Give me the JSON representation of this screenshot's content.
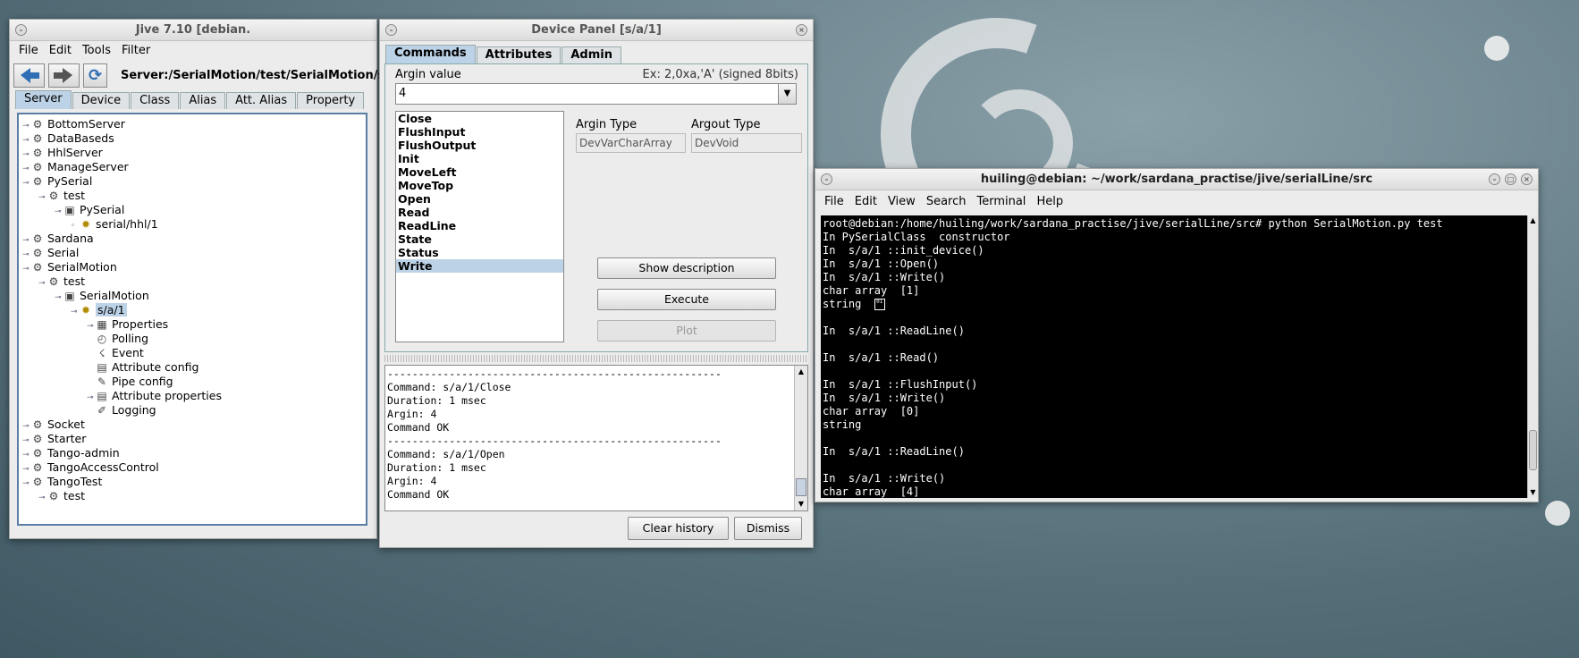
{
  "jive": {
    "title": "Jive 7.10 [debian.",
    "menus": [
      "File",
      "Edit",
      "Tools",
      "Filter"
    ],
    "path": "Server:/SerialMotion/test/SerialMotion/s/",
    "tabs": [
      "Server",
      "Device",
      "Class",
      "Alias",
      "Att. Alias",
      "Property"
    ],
    "tree": [
      {
        "label": "BottomServer",
        "icon": "server-icon",
        "depth": 0
      },
      {
        "label": "DataBaseds",
        "icon": "server-icon",
        "depth": 0
      },
      {
        "label": "HhlServer",
        "icon": "server-icon",
        "depth": 0
      },
      {
        "label": "ManageServer",
        "icon": "server-icon",
        "depth": 0
      },
      {
        "label": "PySerial",
        "icon": "server-icon",
        "depth": 0
      },
      {
        "label": "test",
        "icon": "instance-icon",
        "depth": 1
      },
      {
        "label": "PySerial",
        "icon": "class-icon",
        "depth": 2
      },
      {
        "label": "serial/hhl/1",
        "icon": "device-icon",
        "depth": 3
      },
      {
        "label": "Sardana",
        "icon": "server-icon",
        "depth": 0
      },
      {
        "label": "Serial",
        "icon": "server-icon",
        "depth": 0
      },
      {
        "label": "SerialMotion",
        "icon": "server-icon",
        "depth": 0
      },
      {
        "label": "test",
        "icon": "instance-icon",
        "depth": 1
      },
      {
        "label": "SerialMotion",
        "icon": "class-icon",
        "depth": 2
      },
      {
        "label": "s/a/1",
        "icon": "device-icon",
        "depth": 3,
        "selected": true
      },
      {
        "label": "Properties",
        "icon": "properties-icon",
        "depth": 4
      },
      {
        "label": "Polling",
        "icon": "polling-icon",
        "depth": 4
      },
      {
        "label": "Event",
        "icon": "event-icon",
        "depth": 4
      },
      {
        "label": "Attribute config",
        "icon": "attribute-config-icon",
        "depth": 4
      },
      {
        "label": "Pipe config",
        "icon": "pipe-icon",
        "depth": 4
      },
      {
        "label": "Attribute properties",
        "icon": "attribute-properties-icon",
        "depth": 4
      },
      {
        "label": "Logging",
        "icon": "logging-icon",
        "depth": 4
      },
      {
        "label": "Socket",
        "icon": "server-icon",
        "depth": 0
      },
      {
        "label": "Starter",
        "icon": "server-icon",
        "depth": 0
      },
      {
        "label": "Tango-admin",
        "icon": "server-icon",
        "depth": 0
      },
      {
        "label": "TangoAccessControl",
        "icon": "server-icon",
        "depth": 0
      },
      {
        "label": "TangoTest",
        "icon": "server-icon",
        "depth": 0
      },
      {
        "label": "test",
        "icon": "instance-icon",
        "depth": 1
      }
    ]
  },
  "panel": {
    "title": "Device Panel [s/a/1]",
    "tabs": [
      "Commands",
      "Attributes",
      "Admin"
    ],
    "argin_label": "Argin value",
    "argin_example": "Ex: 2,0xa,'A' (signed 8bits)",
    "argin_value": "4",
    "commands": [
      "Close",
      "FlushInput",
      "FlushOutput",
      "Init",
      "MoveLeft",
      "MoveTop",
      "Open",
      "Read",
      "ReadLine",
      "State",
      "Status",
      "Write"
    ],
    "selected_command": "Write",
    "argin_type_label": "Argin Type",
    "argin_type": "DevVarCharArray",
    "argout_type_label": "Argout Type",
    "argout_type": "DevVoid",
    "show_description": "Show description",
    "execute": "Execute",
    "plot": "Plot",
    "history": "------------------------------------------------------\nCommand: s/a/1/Close\nDuration: 1 msec\nArgin: 4\nCommand OK\n------------------------------------------------------\nCommand: s/a/1/Open\nDuration: 1 msec\nArgin: 4\nCommand OK",
    "clear_history": "Clear history",
    "dismiss": "Dismiss"
  },
  "terminal": {
    "title": "huiling@debian: ~/work/sardana_practise/jive/serialLine/src",
    "menus": [
      "File",
      "Edit",
      "View",
      "Search",
      "Terminal",
      "Help"
    ],
    "lines": [
      "root@debian:/home/huiling/work/sardana_practise/jive/serialLine/src# python SerialMotion.py test",
      "In PySerialClass  constructor",
      "In  s/a/1 ::init_device()",
      "In  s/a/1 ::Open()",
      "In  s/a/1 ::Write()",
      "char array  [1]",
      "string  ",
      "",
      "In  s/a/1 ::ReadLine()",
      "",
      "In  s/a/1 ::Read()",
      "",
      "In  s/a/1 ::FlushInput()",
      "In  s/a/1 ::Write()",
      "char array  [0]",
      "string",
      "",
      "In  s/a/1 ::ReadLine()",
      "",
      "In  s/a/1 ::Write()",
      "char array  [4]"
    ]
  }
}
